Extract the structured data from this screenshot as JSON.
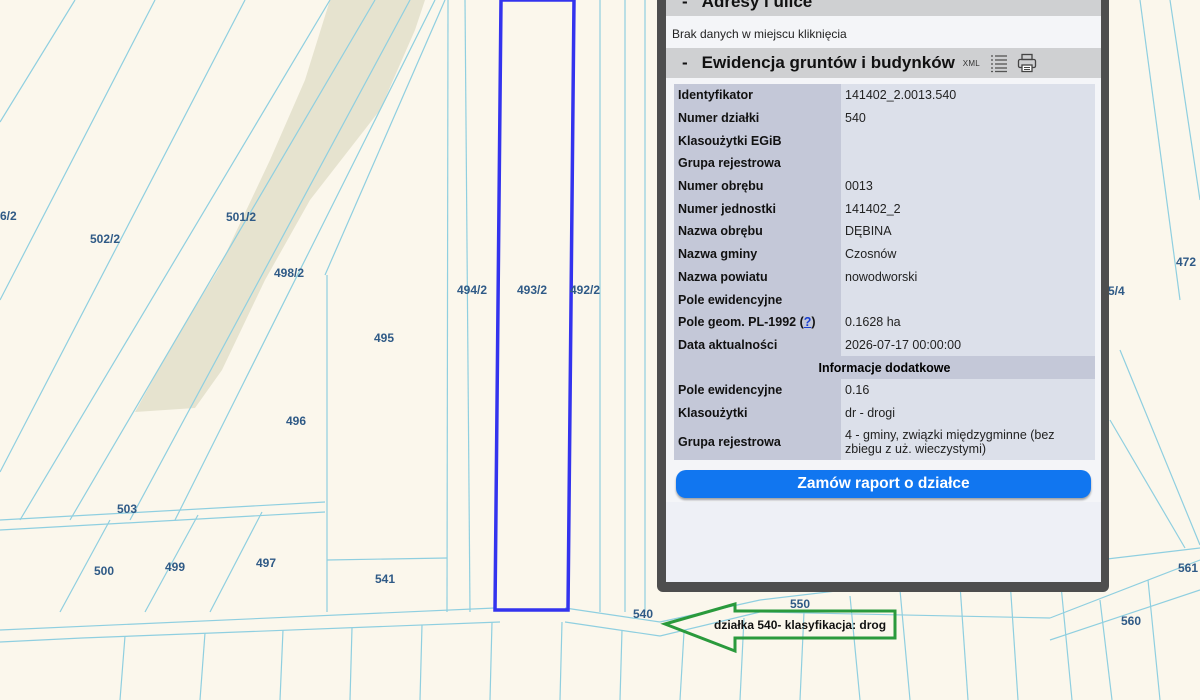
{
  "map": {
    "parcel_labels": [
      "6/2",
      "502/2",
      "501/2",
      "498/2",
      "495",
      "496",
      "494/2",
      "493/2",
      "492/2",
      "503",
      "500",
      "499",
      "497",
      "541",
      "540",
      "550",
      "560",
      "561",
      "5/4",
      "472"
    ],
    "annotation": "działka 540- klasyfikacja: drog",
    "colors": {
      "background": "#fbf7ec",
      "parcel_lines": "#8fcfe0",
      "forest": "#e6e3cf",
      "highlight": "#3333ee",
      "arrow": "#2a9a3c"
    }
  },
  "panel": {
    "address_section": {
      "toggle": "-",
      "title": "Adresy i ulice",
      "message": "Brak danych w miejscu kliknięcia"
    },
    "egib_section": {
      "toggle": "-",
      "title": "Ewidencja gruntów i budynków",
      "xml_label": "XML",
      "rows": [
        {
          "key": "Identyfikator",
          "value": "141402_2.0013.540"
        },
        {
          "key": "Numer działki",
          "value": "540"
        },
        {
          "key": "Klasoużytki EGiB",
          "value": ""
        },
        {
          "key": "Grupa rejestrowa",
          "value": ""
        },
        {
          "key": "Numer obrębu",
          "value": "0013"
        },
        {
          "key": "Numer jednostki",
          "value": "141402_2"
        },
        {
          "key": "Nazwa obrębu",
          "value": "DĘBINA"
        },
        {
          "key": "Nazwa gminy",
          "value": "Czosnów"
        },
        {
          "key": "Nazwa powiatu",
          "value": "nowodworski"
        },
        {
          "key": "Pole ewidencyjne",
          "value": ""
        },
        {
          "key": "Pole geom. PL-1992",
          "help": "?",
          "value": "0.1628 ha"
        },
        {
          "key": "Data aktualności",
          "value": "2026-07-17 00:00:00"
        }
      ],
      "extra_header": "Informacje dodatkowe",
      "extra_rows": [
        {
          "key": "Pole ewidencyjne",
          "value": "0.16"
        },
        {
          "key": "Klasoużytki",
          "value": "dr - drogi"
        },
        {
          "key": "Grupa rejestrowa",
          "value": "4 - gminy, związki międzygminne (bez zbiegu z uż. wieczystymi)"
        }
      ],
      "order_button": "Zamów raport o działce"
    }
  }
}
